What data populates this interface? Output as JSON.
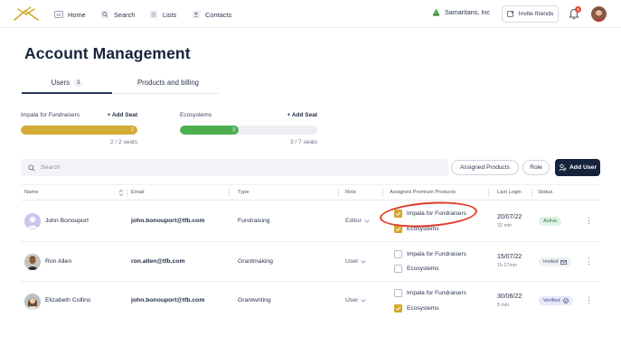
{
  "nav": {
    "logo_icon": "impala-logo",
    "items": [
      {
        "label": "Home",
        "icon": "home-icon"
      },
      {
        "label": "Search",
        "icon": "search-icon"
      },
      {
        "label": "Lists",
        "icon": "list-icon"
      },
      {
        "label": "Contacts",
        "icon": "contacts-icon"
      }
    ],
    "org_name": "Samaritans, Inc",
    "invite_label": "Invite friends",
    "notification_count": "2"
  },
  "page": {
    "title": "Account Management"
  },
  "tabs": [
    {
      "label": "Users",
      "count": "3",
      "active": true
    },
    {
      "label": "Products and billing",
      "count": "",
      "active": false
    }
  ],
  "seats": [
    {
      "product": "Impala for Fundraisers",
      "add_label": "+ Add Seat",
      "used": 2,
      "total": 2,
      "bar_label": "2",
      "count_label": "2 / 2 seats",
      "color": "#d3ac35"
    },
    {
      "product": "Ecosystems",
      "add_label": "+ Add Seat",
      "used": 3,
      "total": 7,
      "bar_label": "3",
      "count_label": "3 / 7 seats",
      "color": "#4caf50"
    }
  ],
  "toolbar": {
    "search_placeholder": "Search",
    "assigned_products_label": "Assigned Products",
    "role_label": "Role",
    "add_user_label": "Add User"
  },
  "table": {
    "columns": [
      "Name",
      "Email",
      "Type",
      "Role",
      "Assigned Premium Products",
      "Last Login",
      "Status"
    ],
    "rows": [
      {
        "name": "John Bonouport",
        "email": "john.bonouport@tfb.com",
        "type": "Fundraising",
        "role": "Editor",
        "products": [
          {
            "label": "Impala for Fundraisers",
            "checked": true
          },
          {
            "label": "Ecosystems",
            "checked": true
          }
        ],
        "last_login_date": "20/07/22",
        "last_login_time": "32 min",
        "status": "Active"
      },
      {
        "name": "Ron Allen",
        "email": "ron.allen@tfb.com",
        "type": "Grantmaking",
        "role": "User",
        "products": [
          {
            "label": "Impala for Fundraisers",
            "checked": false
          },
          {
            "label": "Ecosystems",
            "checked": false
          }
        ],
        "last_login_date": "15/07/22",
        "last_login_time": "1h 27min",
        "status": "Invited"
      },
      {
        "name": "Elizabeth Collins",
        "email": "john.bonouport@tfb.com",
        "type": "Grantwriting",
        "role": "User",
        "products": [
          {
            "label": "Impala for Fundraisers",
            "checked": false
          },
          {
            "label": "Ecosystems",
            "checked": true
          }
        ],
        "last_login_date": "30/06/22",
        "last_login_time": "5 min",
        "status": "Verified"
      }
    ]
  },
  "colors": {
    "navy": "#17233d",
    "gold": "#d3a72c",
    "green": "#4caf50",
    "annotation_red": "#e23a2d"
  }
}
